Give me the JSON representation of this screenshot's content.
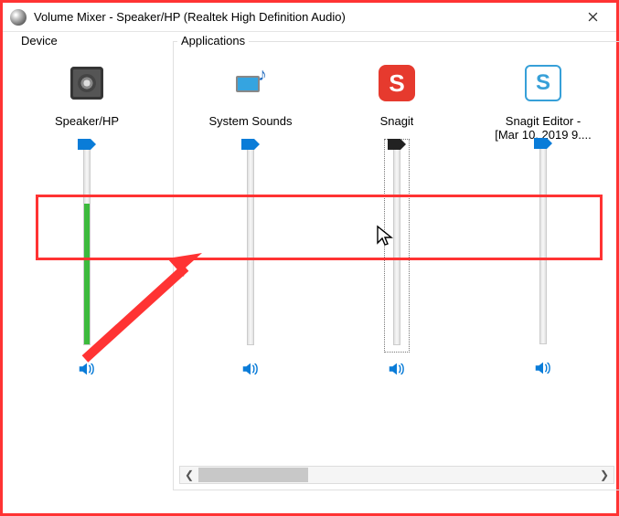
{
  "window": {
    "title": "Volume Mixer - Speaker/HP (Realtek High Definition Audio)"
  },
  "sections": {
    "device": "Device",
    "applications": "Applications"
  },
  "device": {
    "label": "Speaker/HP",
    "volume": 100,
    "level_green": 70
  },
  "apps": [
    {
      "id": "system-sounds",
      "label": "System Sounds",
      "volume": 100
    },
    {
      "id": "snagit",
      "label": "Snagit",
      "volume": 100,
      "focused": true
    },
    {
      "id": "snagit-editor",
      "label": "Snagit Editor -",
      "label2": "[Mar 10, 2019 9....",
      "volume": 100
    }
  ],
  "annotation": {
    "highlight_area": "volume-slider-thumbs-row",
    "arrow": "pointing-to-snagit-slider"
  }
}
